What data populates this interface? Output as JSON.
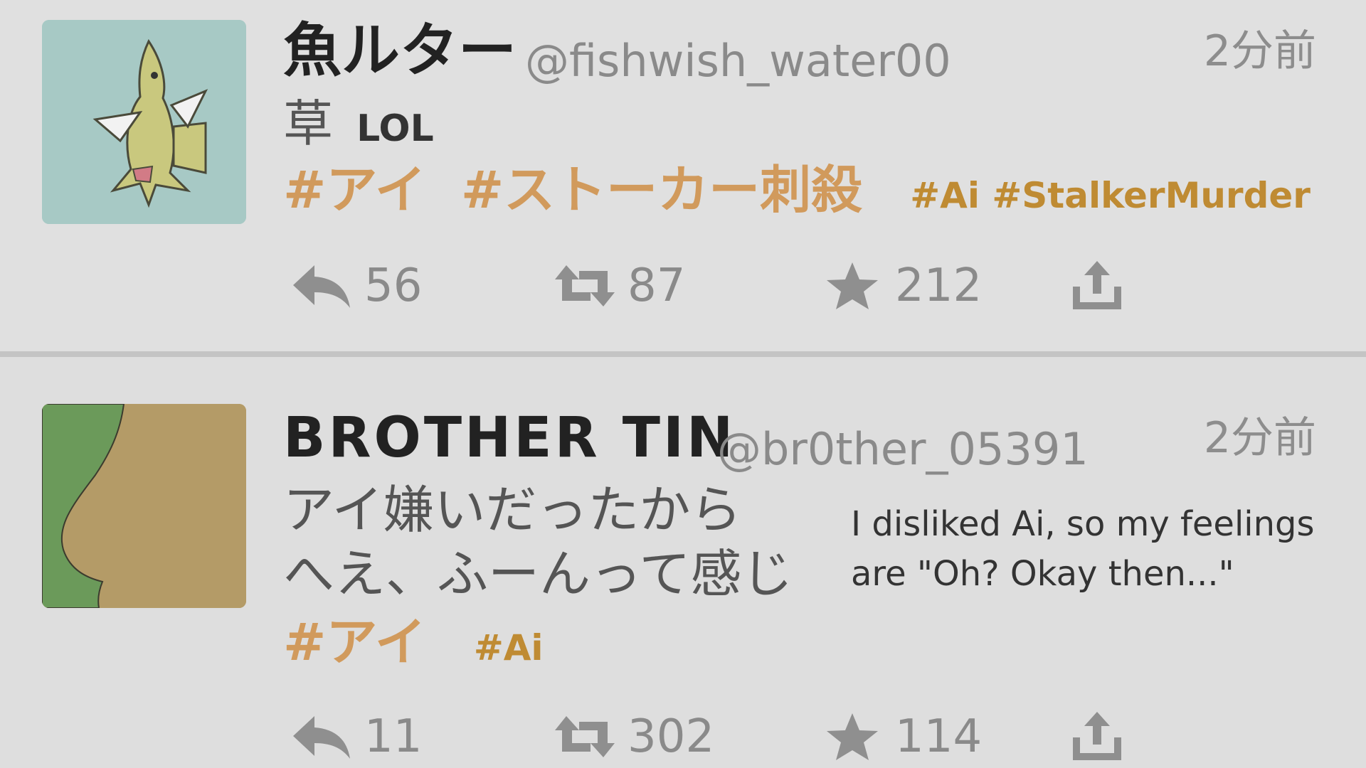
{
  "tweets": [
    {
      "display_name": "魚ルター",
      "handle": "@fishwish_water00",
      "timestamp": "2分前",
      "text_jp": "草",
      "text_en": "LOL",
      "hashtags_jp": [
        "#アイ",
        "#ストーカー刺殺"
      ],
      "hashtags_en": "#Ai #StalkerMurder",
      "replies": "56",
      "retweets": "87",
      "favorites": "212",
      "avatar": "fish-avatar"
    },
    {
      "display_name": "BROTHER TIN",
      "handle": "@br0ther_05391",
      "timestamp": "2分前",
      "text_jp_lines": [
        "アイ嫌いだったから",
        "へえ、ふーんって感じ"
      ],
      "translation_lines": [
        "I disliked Ai, so my feelings",
        "are \"Oh? Okay then...\""
      ],
      "hashtags_jp": [
        "#アイ"
      ],
      "hashtags_en": "#Ai",
      "replies": "11",
      "retweets": "302",
      "favorites": "114",
      "avatar": "nose-profile-avatar"
    }
  ],
  "icons": {
    "reply": "reply-arrow-icon",
    "retweet": "retweet-icon",
    "favorite": "star-icon",
    "share": "share-upload-icon"
  },
  "colors": {
    "hashtag_jp": "#d19a5c",
    "hashtag_en": "#bf8b33",
    "background": "#dcdcdc"
  }
}
